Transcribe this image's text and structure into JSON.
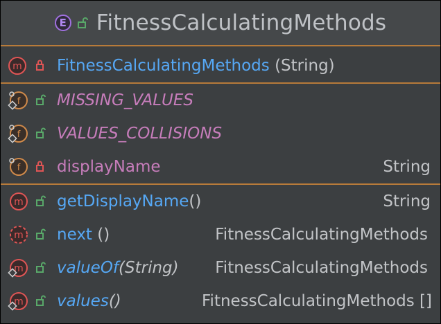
{
  "class": {
    "name": "FitnessCalculatingMethods",
    "kind_badge": "E",
    "colors": {
      "header_bg": "#45484a",
      "body_bg": "#3c3f41",
      "separator": "#b87b3a",
      "method": "#56a8f5",
      "field": "#c77dbb",
      "type": "#c2c4c7",
      "enum_badge": "#a070e0"
    }
  },
  "constructor": {
    "name": "FitnessCalculatingMethods",
    "params": "(String)",
    "icon": "method-icon",
    "visibility": "private-lock-icon"
  },
  "fields": [
    {
      "name": "MISSING_VALUES",
      "type": "",
      "icon": "field-icon",
      "visibility": "public-unlock-icon",
      "static": true,
      "italic": true
    },
    {
      "name": "VALUES_COLLISIONS",
      "type": "",
      "icon": "field-icon",
      "visibility": "public-unlock-icon",
      "static": true,
      "italic": true
    },
    {
      "name": "displayName",
      "type": "String",
      "icon": "field-icon",
      "visibility": "private-lock-icon",
      "static": false,
      "italic": false
    }
  ],
  "methods": [
    {
      "name": "getDisplayName",
      "params": "()",
      "type": "String",
      "icon": "method-icon",
      "visibility": "public-unlock-icon",
      "italic": false
    },
    {
      "name": "next",
      "params": "()",
      "type": "FitnessCalculatingMethods",
      "icon": "abstract-method-icon",
      "visibility": "public-unlock-icon",
      "italic": false
    },
    {
      "name": "valueOf",
      "params": "(String)",
      "type": "FitnessCalculatingMethods",
      "icon": "static-method-icon",
      "visibility": "public-unlock-icon",
      "italic": true
    },
    {
      "name": "values",
      "params": "()",
      "type": "FitnessCalculatingMethods []",
      "icon": "static-method-icon",
      "visibility": "public-unlock-icon",
      "italic": true
    }
  ]
}
